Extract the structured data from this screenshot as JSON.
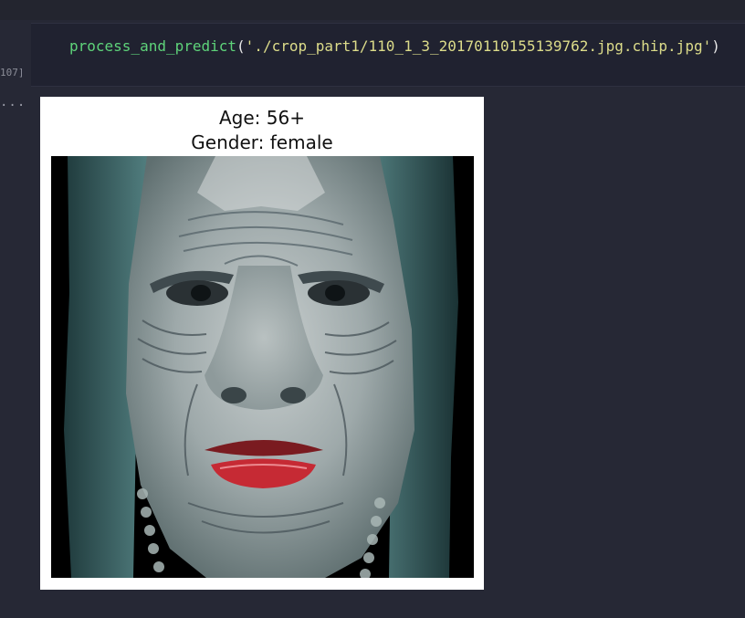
{
  "notebook": {
    "execution_count": "107]",
    "output_prompt": "...",
    "code": {
      "function_name": "process_and_predict",
      "open_paren": "(",
      "argument": "'./crop_part1/110_1_3_20170110155139762.jpg.chip.jpg'",
      "close_paren": ")"
    }
  },
  "figure": {
    "title_line1": "Age: 56+",
    "title_line2": "Gender: female",
    "image_subject": "face-photo"
  },
  "colors": {
    "background": "#262835",
    "code_cell": "#202230",
    "function_color": "#5ed37a",
    "string_color": "#dcdc8a"
  }
}
